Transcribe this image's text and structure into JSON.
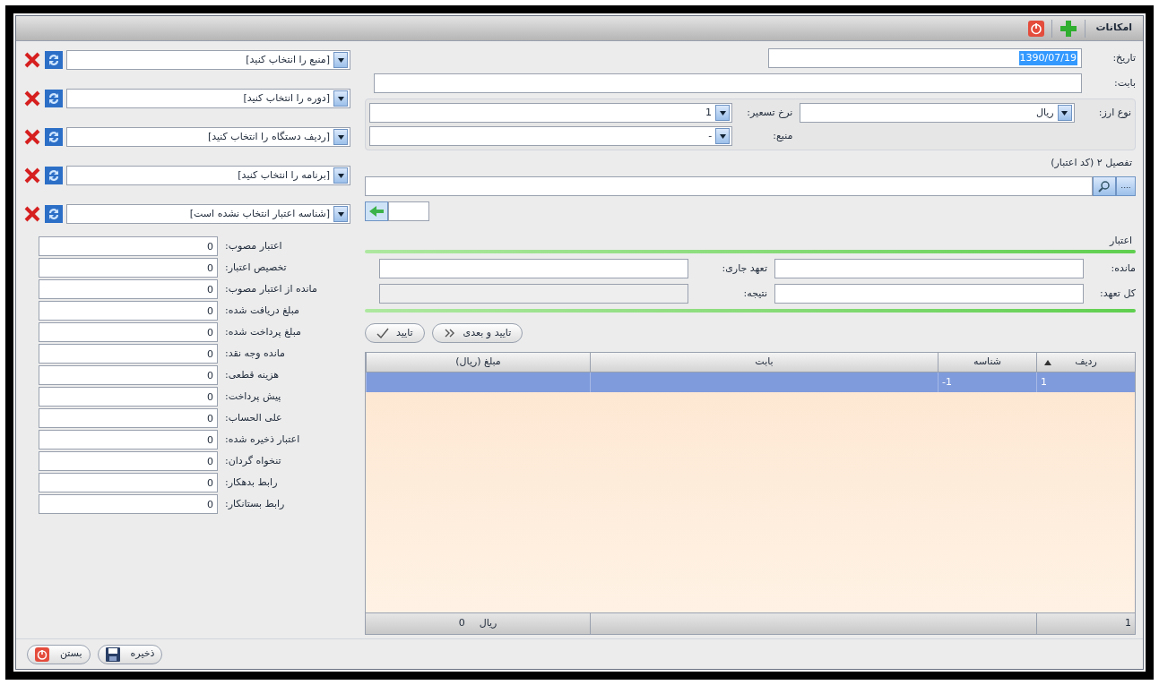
{
  "window": {
    "title": "امکانات"
  },
  "form": {
    "date": {
      "label": "تاریخ:",
      "value": "1390/07/19"
    },
    "subject": {
      "label": "بابت:"
    },
    "currency": {
      "label": "نوع ارز:",
      "value": "ریال"
    },
    "rate": {
      "label": "نرخ تسعیر:",
      "value": "1"
    },
    "source": {
      "label": "منبع:",
      "value": "-"
    },
    "detail": {
      "label": "تفصیل ۲ (کد اعتبار)",
      "button": "...."
    }
  },
  "credit": {
    "title": "اعتبار",
    "fields": [
      {
        "label": "مانده:"
      },
      {
        "label": "تعهد جاری:"
      },
      {
        "label": "کل تعهد:"
      },
      {
        "label": "نتیجه:",
        "disabled": true
      }
    ]
  },
  "actions": [
    {
      "label": "تایید و بعدی",
      "kind": "next"
    },
    {
      "label": "تایید",
      "kind": "ok"
    }
  ],
  "table": {
    "columns": [
      "ردیف",
      "شناسه",
      "بابت",
      "مبلغ (ریال)"
    ],
    "rows": [
      {
        "cells": [
          "1",
          "-1",
          "",
          ""
        ],
        "selected": true
      }
    ],
    "footer": {
      "count": "1",
      "unit": "ریال",
      "total": "0"
    }
  },
  "selectors": [
    {
      "placeholder": "[منبع را انتخاب کنید]"
    },
    {
      "placeholder": "[دوره را انتخاب کنید]"
    },
    {
      "placeholder": "[ردیف دستگاه را انتخاب کنید]"
    },
    {
      "placeholder": "[برنامه را انتخاب کنید]"
    },
    {
      "placeholder": "[شناسه اعتبار انتخاب نشده است]"
    }
  ],
  "summary": [
    {
      "label": "اعتبار مصوب:",
      "value": "0"
    },
    {
      "label": "تخصیص اعتبار:",
      "value": "0"
    },
    {
      "label": "مانده از اعتبار مصوب:",
      "value": "0"
    },
    {
      "label": "مبلغ دریافت شده:",
      "value": "0"
    },
    {
      "label": "مبلغ پرداخت شده:",
      "value": "0"
    },
    {
      "label": "مانده وجه نقد:",
      "value": "0"
    },
    {
      "label": "هزینه قطعی:",
      "value": "0"
    },
    {
      "label": "پیش پرداخت:",
      "value": "0"
    },
    {
      "label": "علی الحساب:",
      "value": "0"
    },
    {
      "label": "اعتبار ذخیره شده:",
      "value": "0"
    },
    {
      "label": "تنخواه گردان:",
      "value": "0"
    },
    {
      "label": "رابط بدهکار:",
      "value": "0"
    },
    {
      "label": "رابط بستانکار:",
      "value": "0"
    }
  ],
  "bottom_buttons": [
    {
      "label": "ذخیره",
      "kind": "save"
    },
    {
      "label": "بستن",
      "kind": "close"
    }
  ]
}
